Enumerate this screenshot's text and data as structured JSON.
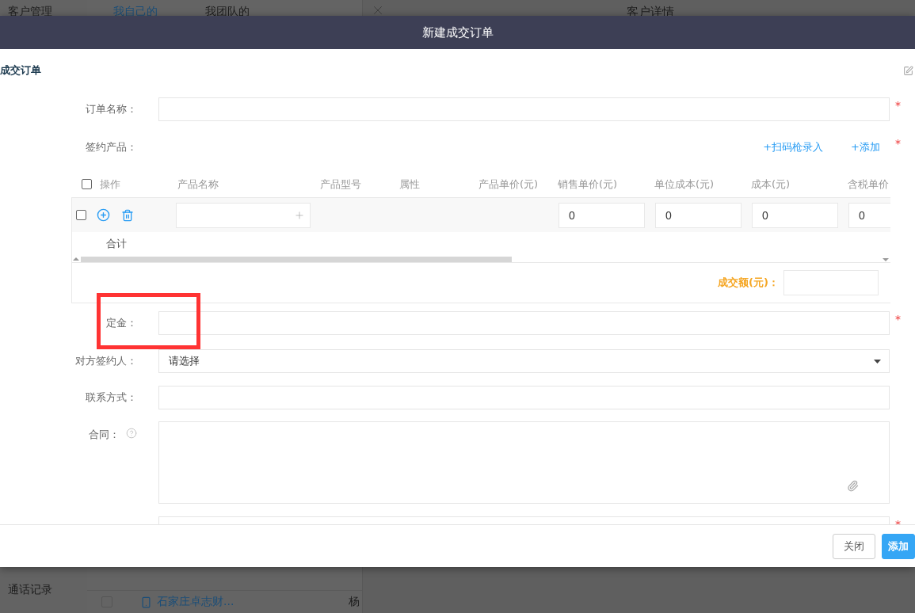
{
  "background": {
    "sidebar": [
      {
        "label": "客户管理"
      },
      {
        "label": "通话记录"
      }
    ],
    "tabs": [
      {
        "label": "我自己的",
        "selected": true
      },
      {
        "label": "我团队的",
        "selected": false
      }
    ],
    "detail_title": "客户详情",
    "list_rows": [
      {
        "checked": false,
        "name": "石家庄卓志财...",
        "column_2": "杨"
      }
    ]
  },
  "dialog": {
    "title": "新建成交订单",
    "section_title": "成交订单",
    "fields": [
      {
        "kind": "text",
        "label": "订单名称：",
        "required_mark": "*",
        "highlighted": false
      },
      {
        "kind": "products",
        "label": "签约产品：",
        "required_mark": "*",
        "highlighted": false,
        "actions": [
          "+扫码枪录入",
          "+添加"
        ]
      },
      {
        "kind": "text",
        "label": "定金：",
        "required_mark": "*",
        "highlighted": true
      },
      {
        "kind": "select",
        "label": "对方签约人：",
        "placeholder": "请选择",
        "highlighted": false
      },
      {
        "kind": "text",
        "label": "联系方式：",
        "highlighted": false
      },
      {
        "kind": "textarea",
        "label": "合同：",
        "help": true,
        "highlighted": false
      },
      {
        "kind": "text",
        "required_mark": "*",
        "highlighted": false
      }
    ],
    "products": {
      "header_checked": false,
      "columns": [
        "操作",
        "产品名称",
        "产品型号",
        "属性",
        "产品单价(元)",
        "销售单价(元)",
        "单位成本(元)",
        "成本(元)",
        "含税单价"
      ],
      "rows": [
        {
          "checked": false,
          "values": [
            "0",
            "0",
            "0",
            "0"
          ]
        }
      ],
      "total_label": "合计",
      "amount_label": "成交额(元)："
    },
    "buttons": [
      {
        "label": "关闭",
        "kind": "default"
      },
      {
        "label": "添加",
        "kind": "primary"
      }
    ]
  }
}
